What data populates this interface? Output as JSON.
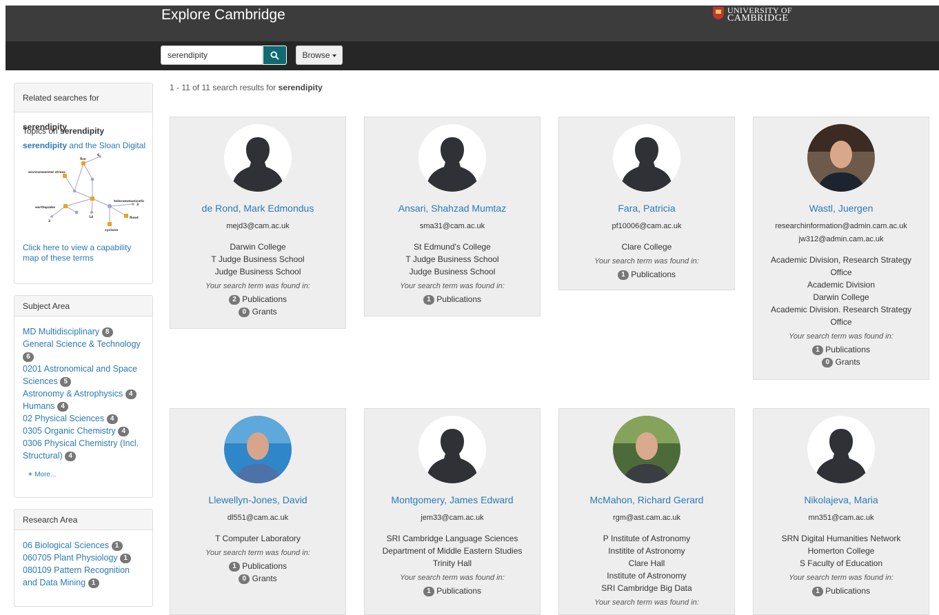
{
  "header": {
    "title": "Explore Cambridge",
    "logo_line1": "UNIVERSITY OF",
    "logo_line2": "CAMBRIDGE"
  },
  "search": {
    "value": "serendipity",
    "browse_label": "Browse"
  },
  "results_summary": {
    "prefix": "1 - 11 of 11 search results for",
    "term": "serendipity"
  },
  "sidebar": {
    "related": {
      "title_prefix": "Related searches for",
      "term": "serendipity",
      "topics_prefix": "Topics on",
      "topics_term": "serendipity",
      "topic_link_term": "serendipity",
      "topic_link_rest": " and the Sloan Digital",
      "map_labels": [
        "environmental stress",
        "fire",
        "earthquake",
        "telecommunications",
        "flood",
        "cyclone",
        "6",
        "3",
        "14",
        "3"
      ],
      "map_link": "Click here to view a capability map of these terms"
    },
    "subject": {
      "title": "Subject Area",
      "items": [
        {
          "label": "MD Multidisciplinary",
          "count": "8"
        },
        {
          "label": "General Science & Technology",
          "count": "6"
        },
        {
          "label": "0201 Astronomical and Space Sciences",
          "count": "5"
        },
        {
          "label": "Astronomy & Astrophysics",
          "count": "4"
        },
        {
          "label": "Humans",
          "count": "4"
        },
        {
          "label": "02 Physical Sciences",
          "count": "4"
        },
        {
          "label": "0305 Organic Chemistry",
          "count": "4"
        },
        {
          "label": "0306 Physical Chemistry (Incl. Structural)",
          "count": "4"
        }
      ],
      "more_label": "More..."
    },
    "research": {
      "title": "Research Area",
      "items": [
        {
          "label": "06 Biological Sciences",
          "count": "1"
        },
        {
          "label": "060705 Plant Physiology",
          "count": "1"
        },
        {
          "label": "080109 Pattern Recognition and Data Mining",
          "count": "1"
        }
      ]
    }
  },
  "found_label": "Your search term was found in:",
  "cards": [
    {
      "name": "de Rond, Mark Edmondus",
      "emails": [
        "mejd3@cam.ac.uk"
      ],
      "affiliations": [
        "Darwin College",
        "T Judge Business School",
        "Judge Business School"
      ],
      "counts": [
        {
          "n": "2",
          "label": "Publications"
        },
        {
          "n": "0",
          "label": "Grants"
        }
      ]
    },
    {
      "name": "Ansari, Shahzad Mumtaz",
      "emails": [
        "sma31@cam.ac.uk"
      ],
      "affiliations": [
        "St Edmund's College",
        "T Judge Business School",
        "Judge Business School"
      ],
      "counts": [
        {
          "n": "1",
          "label": "Publications"
        }
      ]
    },
    {
      "name": "Fara, Patricia",
      "emails": [
        "pf10006@cam.ac.uk"
      ],
      "affiliations": [
        "Clare College"
      ],
      "counts": [
        {
          "n": "1",
          "label": "Publications"
        }
      ]
    },
    {
      "name": "Wastl, Juergen",
      "emails": [
        "researchinformation@admin.cam.ac.uk",
        "jw312@admin.cam.ac.uk"
      ],
      "affiliations": [
        "Academic Division, Research Strategy Office",
        "Academic Division",
        "Darwin College",
        "Academic Division. Research Strategy Office"
      ],
      "counts": [
        {
          "n": "1",
          "label": "Publications"
        },
        {
          "n": "0",
          "label": "Grants"
        }
      ]
    },
    {
      "name": "Llewellyn-Jones, David",
      "emails": [
        "dl551@cam.ac.uk"
      ],
      "affiliations": [
        "T Computer Laboratory"
      ],
      "counts": [
        {
          "n": "1",
          "label": "Publications"
        },
        {
          "n": "0",
          "label": "Grants"
        }
      ]
    },
    {
      "name": "Montgomery, James Edward",
      "emails": [
        "jem33@cam.ac.uk"
      ],
      "affiliations": [
        "SRI Cambridge Language Sciences",
        "Department of Middle Eastern Studies",
        "Trinity Hall"
      ],
      "counts": [
        {
          "n": "1",
          "label": "Publications"
        }
      ]
    },
    {
      "name": "McMahon, Richard Gerard",
      "emails": [
        "rgm@ast.cam.ac.uk"
      ],
      "affiliations": [
        "P Institute of Astronomy",
        "Institite of Astronomy",
        "Clare Hall",
        "Institute of Astronomy",
        "SRI Cambridge Big Data"
      ],
      "counts": []
    },
    {
      "name": "Nikolajeva, Maria",
      "emails": [
        "mn351@cam.ac.uk"
      ],
      "affiliations": [
        "SRN Digital Humanities Network",
        "Homerton College",
        "S Faculty of Education"
      ],
      "counts": [
        {
          "n": "1",
          "label": "Publications"
        }
      ]
    }
  ]
}
